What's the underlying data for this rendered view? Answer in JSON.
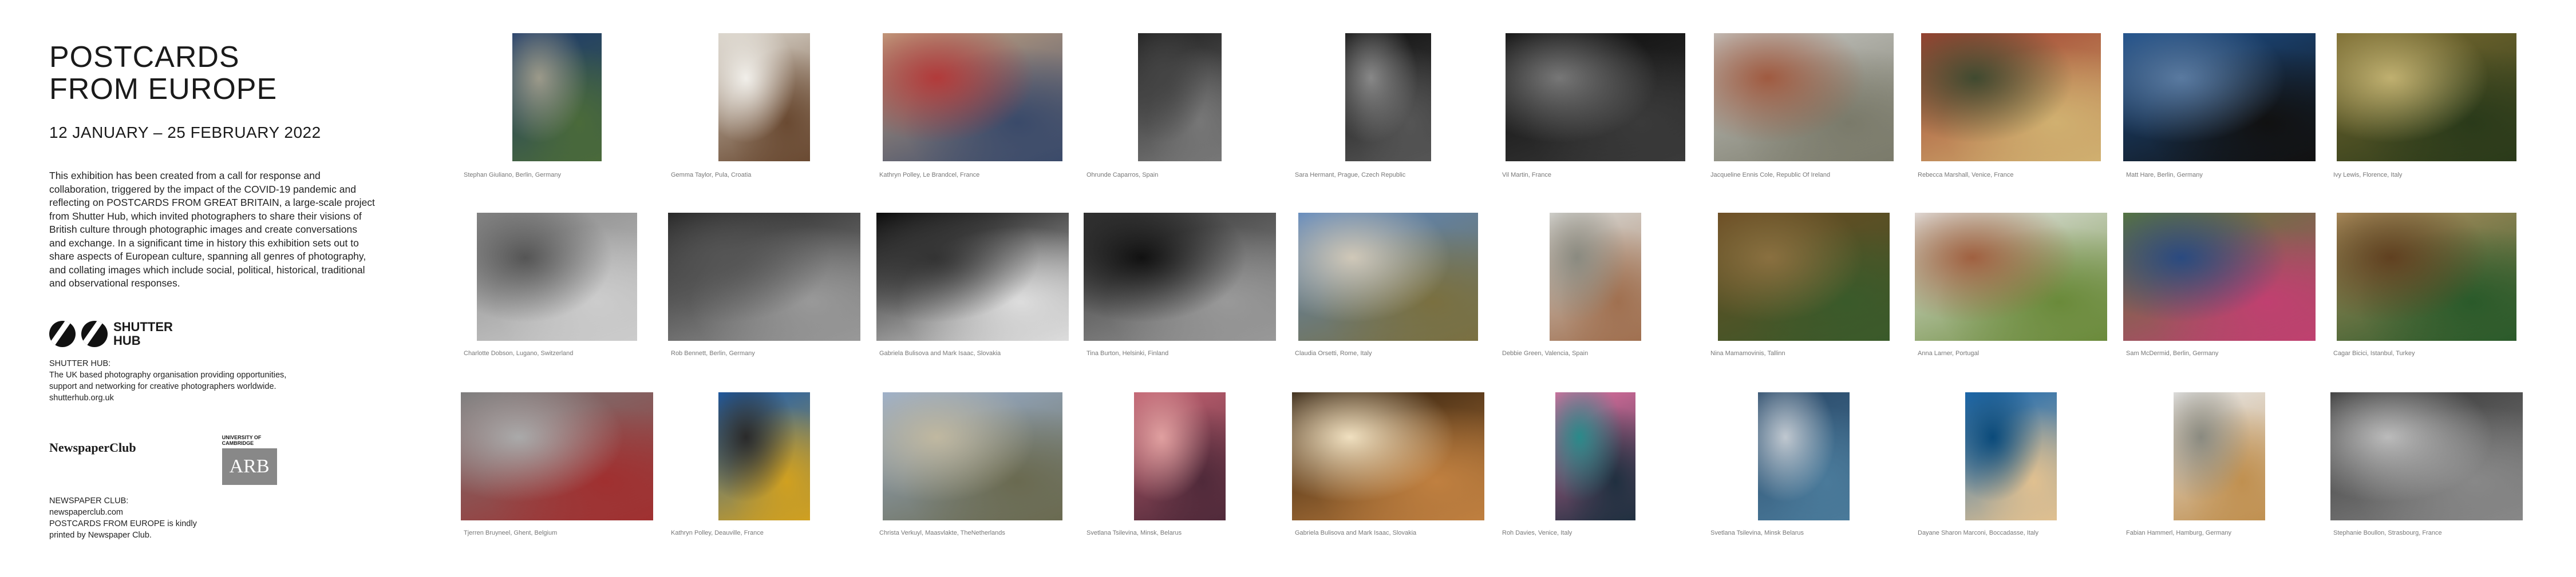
{
  "exhibition": {
    "title_line1": "POSTCARDS",
    "title_line2": "FROM EUROPE",
    "dates": "12 JANUARY – 25 FEBRUARY 2022",
    "description": "This exhibition has been created from a call for response and collaboration, triggered by the impact of the COVID-19 pandemic and reflecting on POSTCARDS FROM GREAT BRITAIN, a large-scale project from Shutter Hub, which invited photographers to share their visions of British culture through photographic images and create conversations and exchange. In a significant time in history this exhibition sets out to share aspects of European culture, spanning all genres of photography, and collating images which include social, political, historical, traditional and observational responses."
  },
  "shutter_hub": {
    "logo_line1": "SHUTTER",
    "logo_line2": "HUB",
    "heading": "SHUTTER HUB:",
    "text": "The UK based photography organisation providing opportunities, support and networking for creative photographers worldwide.",
    "url": "shutterhub.org.uk"
  },
  "newspaper_club": {
    "logo": "NewspaperClub",
    "heading": "NEWSPAPER CLUB:",
    "url": "newspaperclub.com",
    "credit": "POSTCARDS FROM EUROPE is kindly printed by Newspaper Club."
  },
  "arb": {
    "top_line1": "UNIVERSITY OF",
    "top_line2": "CAMBRIDGE",
    "mark": "ARB"
  },
  "photos": [
    {
      "caption": "Stephan Giuliano, Berlin, Germany",
      "colors": [
        "#1d3a6b",
        "#4a6a3a",
        "#9c9a8a"
      ]
    },
    {
      "caption": "Gemma Taylor, Pula, Croatia",
      "colors": [
        "#d8d2c8",
        "#6a4a32",
        "#f1efea"
      ]
    },
    {
      "caption": "Kathryn Polley, Le Brandcel, France",
      "colors": [
        "#c4a382",
        "#3a4a6a",
        "#b23a3a"
      ]
    },
    {
      "caption": "Ohrunde Caparros, Spain",
      "colors": [
        "#222",
        "#777",
        "#444"
      ]
    },
    {
      "caption": "Sara Hermant, Prague, Czech Republic",
      "colors": [
        "#111",
        "#555",
        "#888"
      ]
    },
    {
      "caption": "Vil Martin, France",
      "colors": [
        "#0a0a0a",
        "#3a3a3a",
        "#777"
      ]
    },
    {
      "caption": "Jacqueline Ennis Cole, Republic Of Ireland",
      "colors": [
        "#c6c6c2",
        "#7a7a6a",
        "#a05a40"
      ]
    },
    {
      "caption": "Rebecca Marshall, Venice, France",
      "colors": [
        "#a04030",
        "#d0b070",
        "#404a30"
      ]
    },
    {
      "caption": "Matt Hare, Berlin, Germany",
      "colors": [
        "#1d4f8a",
        "#111",
        "#5a7aa0"
      ]
    },
    {
      "caption": "Ivy Lewis, Florence, Italy",
      "colors": [
        "#7a6a30",
        "#2a3a1a",
        "#c0b070"
      ]
    },
    {
      "caption": "Charlotte Dobson, Lugano, Switzerland",
      "colors": [
        "#888",
        "#ccc",
        "#555"
      ]
    },
    {
      "caption": "Rob Bennett, Berlin, Germany",
      "colors": [
        "#222",
        "#999",
        "#555"
      ]
    },
    {
      "caption": "Gabriela Bulisova and Mark Isaac, Slovakia",
      "colors": [
        "#050505",
        "#ddd",
        "#333"
      ]
    },
    {
      "caption": "Tina Burton, Helsinki, Finland",
      "colors": [
        "#333",
        "#999",
        "#111"
      ]
    },
    {
      "caption": "Claudia Orsetti, Rome, Italy",
      "colors": [
        "#5a86c0",
        "#7a7040",
        "#d0c8b8"
      ]
    },
    {
      "caption": "Debbie Green, Valencia, Spain",
      "colors": [
        "#d8d8d4",
        "#a07050",
        "#8a8a80"
      ]
    },
    {
      "caption": "Nina Mamamovinis, Tallinn",
      "colors": [
        "#6a4a22",
        "#3a5a2a",
        "#8a7040"
      ]
    },
    {
      "caption": "Anna Larner, Portugal",
      "colors": [
        "#e8e8e8",
        "#6a8a3a",
        "#a06040"
      ]
    },
    {
      "caption": "Sam McDermid, Berlin, Germany",
      "colors": [
        "#5a7a3a",
        "#c04070",
        "#2a4a80"
      ]
    },
    {
      "caption": "Cagar Bicici, Istanbul, Turkey",
      "colors": [
        "#b09060",
        "#2a5a2a",
        "#604020"
      ]
    },
    {
      "caption": "Tjerren Bruyneel, Ghent, Belgium",
      "colors": [
        "#777",
        "#a03030",
        "#aaa"
      ]
    },
    {
      "caption": "Kathryn Polley, Deauville, France",
      "colors": [
        "#1d5fb0",
        "#d0a020",
        "#2a2a2a"
      ]
    },
    {
      "caption": "Christa Verkuyl, Maasvlakte, TheNetherlands",
      "colors": [
        "#9ab0d0",
        "#6a6a50",
        "#c0b8a0"
      ]
    },
    {
      "caption": "Svetlana Tsilevina, Minsk, Belarus",
      "colors": [
        "#c06070",
        "#502a3a",
        "#e0a0a0"
      ]
    },
    {
      "caption": "Gabriela Bulisova and Mark Isaac, Slovakia",
      "colors": [
        "#2a1a0a",
        "#c08040",
        "#f0e0c0"
      ]
    },
    {
      "caption": "Roh Davies, Venice, Italy",
      "colors": [
        "#e070a0",
        "#203040",
        "#2a8a8a"
      ]
    },
    {
      "caption": "Svetlana Tsilevina, Minsk Belarus",
      "colors": [
        "#2a4a6a",
        "#4a7a9a",
        "#c0c8d0"
      ]
    },
    {
      "caption": "Dayane Sharon Marconi, Boccadasse, Italy",
      "colors": [
        "#1d6ab0",
        "#e0c090",
        "#0a4a7a"
      ]
    },
    {
      "caption": "Fabian Hammerl, Hamburg, Germany",
      "colors": [
        "#e8e8e8",
        "#c09050",
        "#8a8a80"
      ]
    },
    {
      "caption": "Stephanie Boullon, Strasbourg, France",
      "colors": [
        "#333",
        "#888",
        "#bbb"
      ]
    }
  ]
}
